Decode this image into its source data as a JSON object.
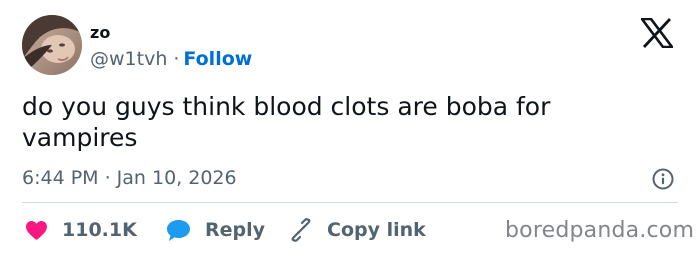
{
  "author": {
    "display_name": "zo",
    "handle": "@w1tvh",
    "separator": "·",
    "follow_label": "Follow"
  },
  "tweet": {
    "text": "do you guys think blood clots are boba for vampires",
    "timestamp": "6:44 PM · Jan 10, 2026"
  },
  "actions": {
    "like_count": "110.1K",
    "reply_label": "Reply",
    "copy_link_label": "Copy link"
  },
  "watermark": "boredpanda.com",
  "icons": {
    "logo": "x-logo-icon",
    "info": "info-icon",
    "like": "heart-icon",
    "reply": "speech-bubble-icon",
    "copy": "link-icon"
  },
  "colors": {
    "text": "#0f1419",
    "secondary": "#536471",
    "link": "#006fd6",
    "like": "#f91880",
    "reply": "#1d9bf0",
    "divider": "#cfd9de"
  }
}
